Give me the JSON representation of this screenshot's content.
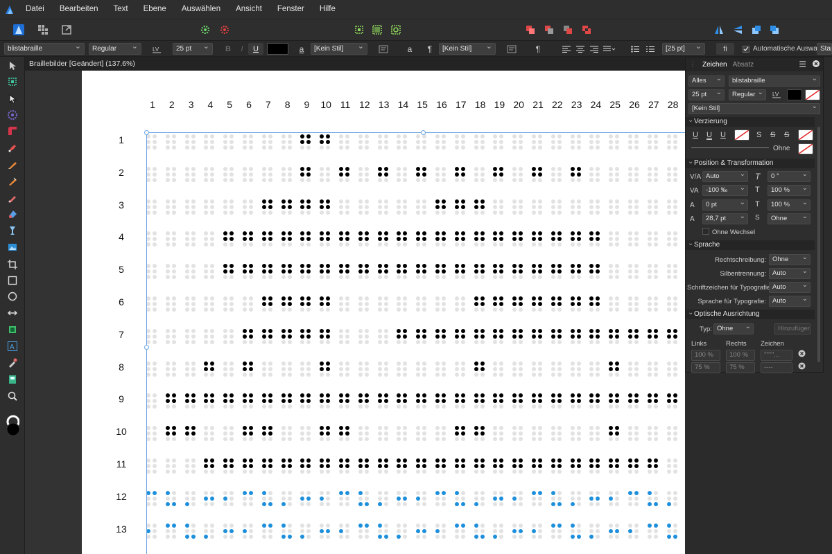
{
  "menubar": {
    "items": [
      "Datei",
      "Bearbeiten",
      "Text",
      "Ebene",
      "Auswählen",
      "Ansicht",
      "Fenster",
      "Hilfe"
    ]
  },
  "context": {
    "font": "blistabraille",
    "style": "Regular",
    "size": "25 pt",
    "bold": "B",
    "italic": "I",
    "underline": "U",
    "char_style_icon": "a",
    "char_style": "[Kein Stil]",
    "para_icon_a": "a",
    "para_mark": "¶",
    "para_style": "[Kein Stil]",
    "para_mark2": "¶",
    "leading": "[25 pt]",
    "fi": "fi",
    "auto_select": "Automatische Auswahl:",
    "auto_select_value": "Stand"
  },
  "document": {
    "tab_title": "Braillebilder [Geändert] (137.6%)",
    "columns": [
      "1",
      "2",
      "3",
      "4",
      "5",
      "6",
      "7",
      "8",
      "9",
      "10",
      "11",
      "12",
      "13",
      "14",
      "15",
      "16",
      "17",
      "18",
      "19",
      "20",
      "21",
      "22",
      "23",
      "24",
      "25",
      "26",
      "27",
      "28"
    ],
    "rows": [
      "1",
      "2",
      "3",
      "4",
      "5",
      "6",
      "7",
      "8",
      "9",
      "10",
      "11",
      "12",
      "13"
    ]
  },
  "braille": {
    "grid_black": [
      "........##..................",
      "........#.#.#.#.#.#.#.#.....",
      "......####.....###..........",
      "....####################....",
      "....####################....",
      "......####.......#######....",
      ".....#####...###############",
      "...#.#...#.......#......#...",
      ".############################",
      ".##..##..##.....##......#...",
      "...########################.."
    ],
    "colors": {
      "black": "#000000",
      "blue": "#1e8fdb",
      "empty": "#e2e2e2"
    }
  },
  "panel": {
    "tab_zeichen": "Zeichen",
    "tab_absatz": "Absatz",
    "filter": "Alles",
    "font": "blistabraille",
    "size": "25 pt",
    "style": "Regular",
    "style_value": "[Kein Stil]",
    "sec_verzierung": "Verzierung",
    "u1": "U",
    "u2": "U",
    "u3": "U",
    "s1": "S",
    "s2": "S",
    "s3": "S",
    "ohne": "Ohne",
    "sec_position": "Position & Transformation",
    "kerning": "Auto",
    "italic_angle": "0 °",
    "tracking": "-100 ‰",
    "hscale": "100 %",
    "baseline": "0 pt",
    "vscale": "100 %",
    "leading": "28,7 pt",
    "ligature": "Ohne",
    "ohne_wechsel": "Ohne Wechsel",
    "sec_sprache": "Sprache",
    "rechtschreibung_label": "Rechtschreibung:",
    "rechtschreibung": "Ohne",
    "silbentrennung_label": "Silbentrennung:",
    "silbentrennung": "Auto",
    "schrift_label": "Schriftzeichen für Typografie:",
    "schrift": "Auto",
    "sprache_typo_label": "Sprache für Typografie:",
    "sprache_typo": "Auto",
    "sec_optisch": "Optische Ausrichtung",
    "typ_label": "Typ:",
    "typ": "Ohne",
    "hinzufuegen": "Hinzufügen",
    "col_links": "Links",
    "col_rechts": "Rechts",
    "col_zeichen": "Zeichen",
    "row1_links": "100 %",
    "row1_rechts": "100 %",
    "row1_zeichen": "'\"'''''...",
    "row2_links": "75 %",
    "row2_rechts": "75 %",
    "row2_zeichen": "----"
  }
}
